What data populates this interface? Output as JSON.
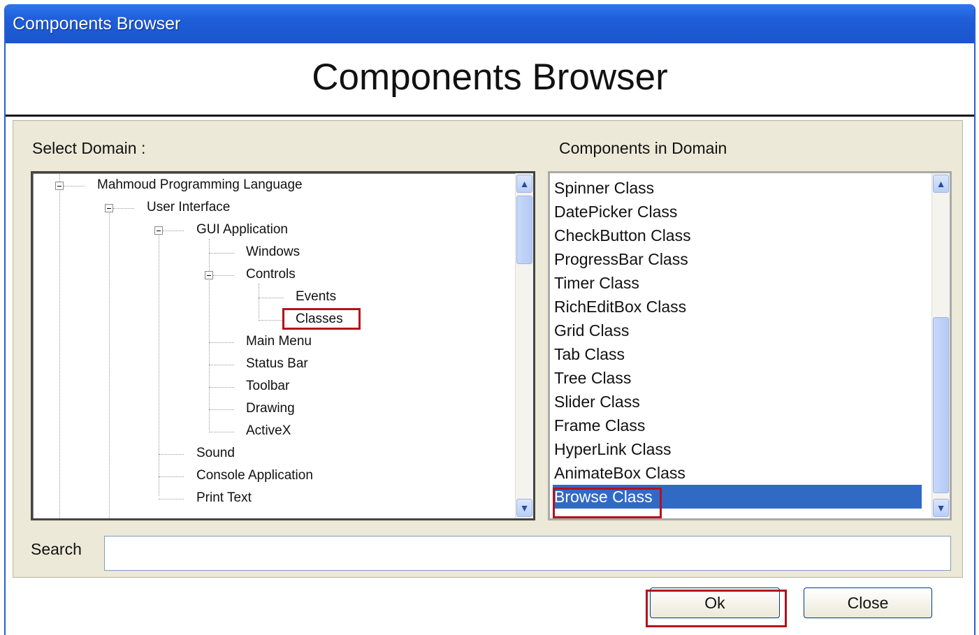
{
  "window": {
    "title": "Components Browser"
  },
  "header": {
    "title": "Components Browser"
  },
  "left": {
    "label": "Select Domain :",
    "tree": [
      "Mahmoud Programming Language",
      "User Interface",
      "GUI Application",
      "Windows",
      "Controls",
      "Events",
      "Classes",
      "Main Menu",
      "Status Bar",
      "Toolbar",
      "Drawing",
      "ActiveX",
      "Sound",
      "Console Application",
      "Print Text"
    ],
    "selected": "Classes"
  },
  "right": {
    "label": "Components in Domain",
    "items": [
      "Spinner Class",
      "DatePicker Class",
      "CheckButton Class",
      "ProgressBar Class",
      "Timer Class",
      "RichEditBox Class",
      "Grid Class",
      "Tab Class",
      "Tree Class",
      "Slider Class",
      "Frame Class",
      "HyperLink Class",
      "AnimateBox Class",
      "Browse Class"
    ],
    "selected": "Browse Class"
  },
  "search": {
    "label": "Search",
    "value": ""
  },
  "buttons": {
    "ok": "Ok",
    "close": "Close"
  },
  "colors": {
    "titlebar": "#1e5ed8",
    "selection": "#316ac5",
    "highlight_box": "#b3121c"
  },
  "icons": {
    "scroll_up": "chevron-up-icon",
    "scroll_down": "chevron-down-icon",
    "tree_toggle": "minus-box-icon"
  }
}
